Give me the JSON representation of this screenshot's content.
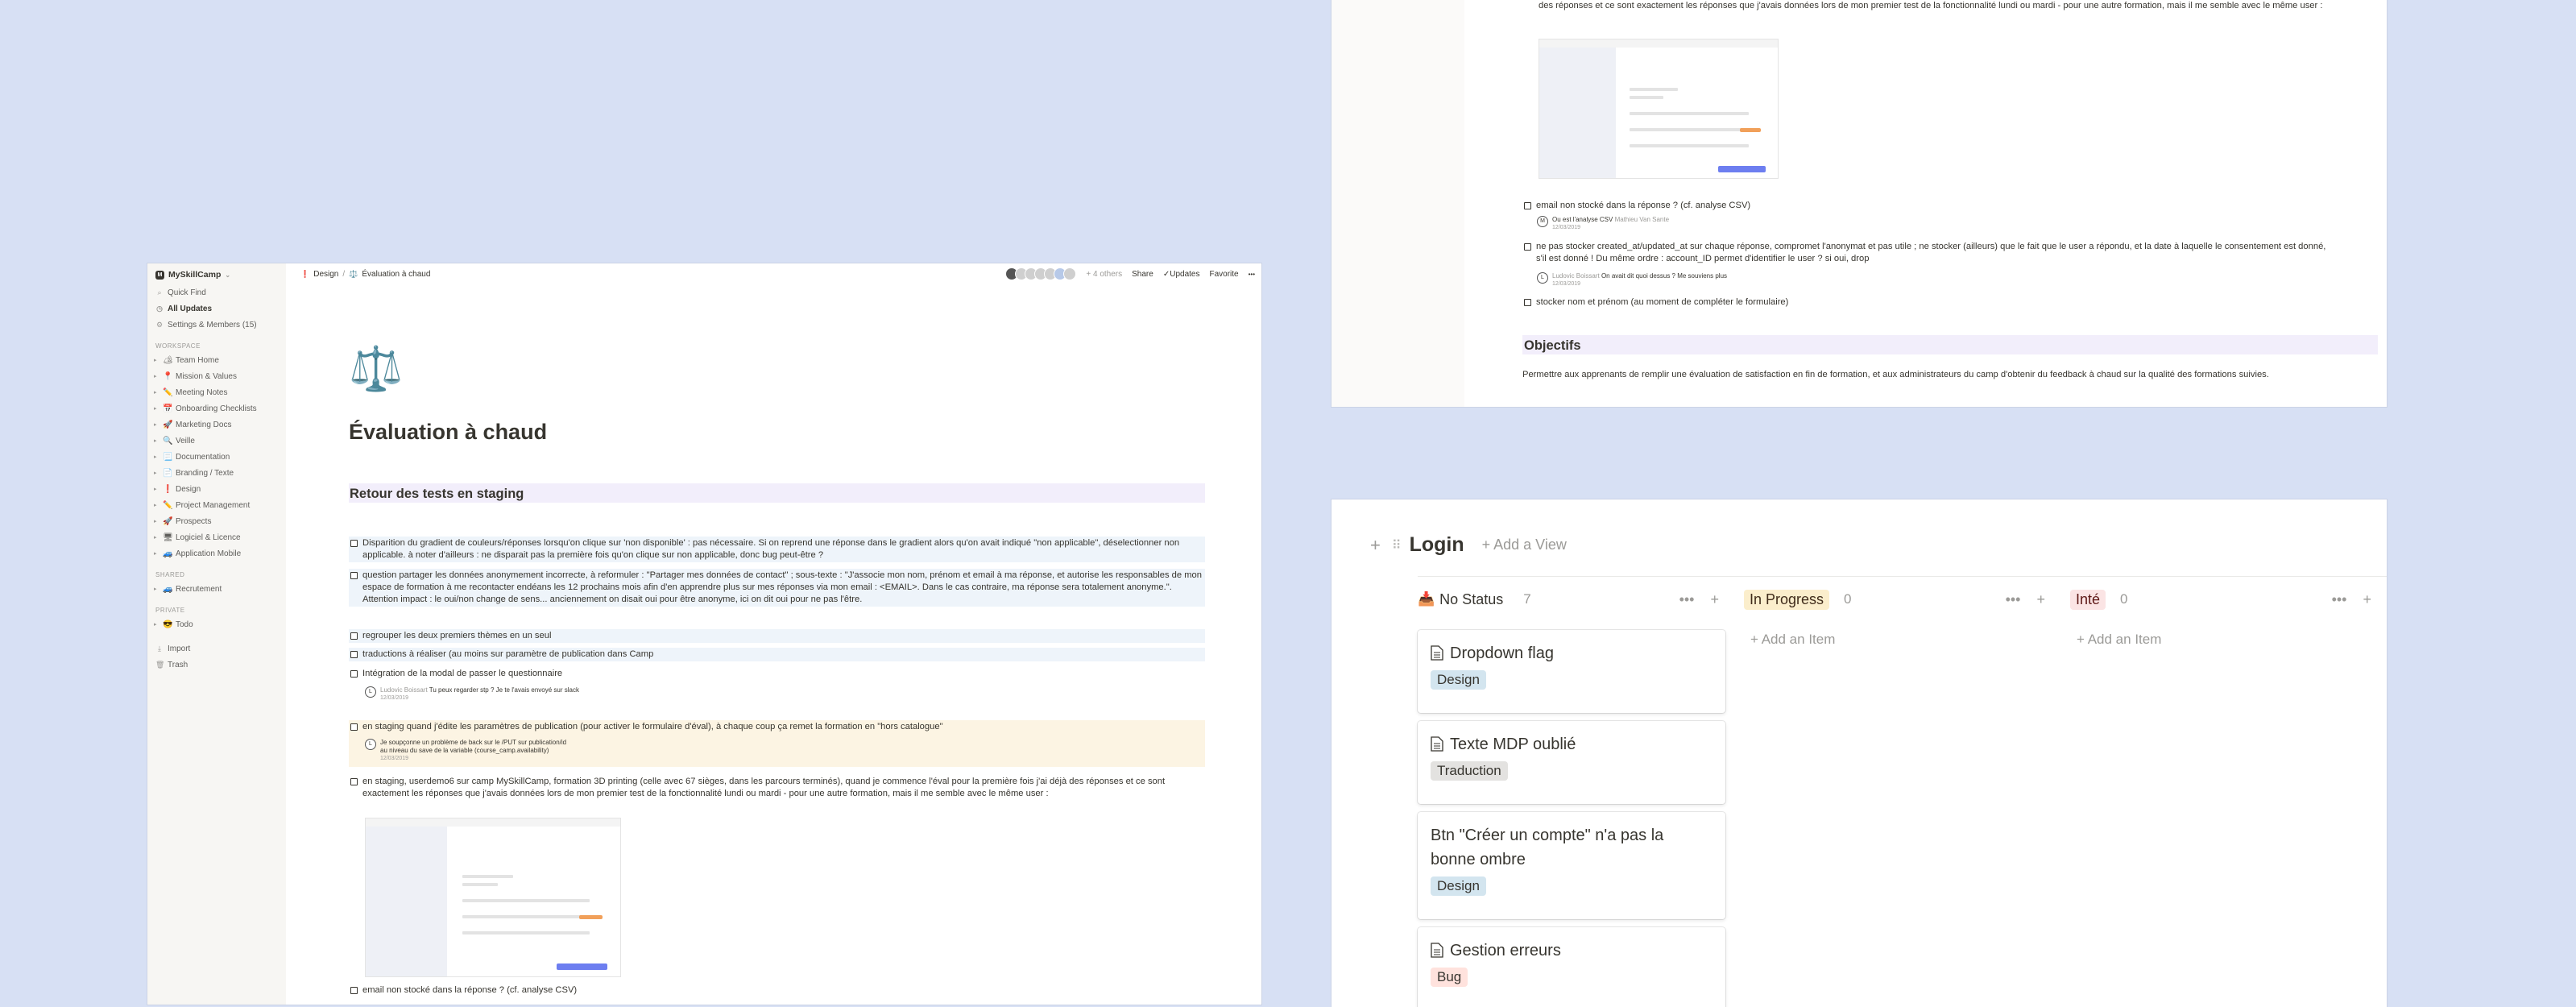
{
  "sidebar": {
    "workspace_name": "MySkillCamp",
    "quick_find": "Quick Find",
    "all_updates": "All Updates",
    "settings": "Settings & Members (15)",
    "workspace_label": "WORKSPACE",
    "items": [
      {
        "emoji": "🏕",
        "label": "Team Home"
      },
      {
        "emoji": "📍",
        "label": "Mission & Values"
      },
      {
        "emoji": "✏️",
        "label": "Meeting Notes"
      },
      {
        "emoji": "📅",
        "label": "Onboarding Checklists"
      },
      {
        "emoji": "🚀",
        "label": "Marketing Docs"
      },
      {
        "emoji": "🔍",
        "label": "Veille"
      },
      {
        "emoji": "📃",
        "label": "Documentation"
      },
      {
        "emoji": "📄",
        "label": "Branding / Texte"
      },
      {
        "emoji": "❗",
        "label": "Design"
      },
      {
        "emoji": "✏️",
        "label": "Project Management"
      },
      {
        "emoji": "🚀",
        "label": "Prospects"
      },
      {
        "emoji": "🖥",
        "label": "Logiciel & Licence"
      },
      {
        "emoji": "🚙",
        "label": "Application Mobile"
      }
    ],
    "shared_label": "SHARED",
    "shared_items": [
      {
        "emoji": "🚙",
        "label": "Recrutement"
      }
    ],
    "private_label": "PRIVATE",
    "private_items": [
      {
        "emoji": "😎",
        "label": "Todo"
      }
    ],
    "import": "Import",
    "trash": "Trash"
  },
  "topbar": {
    "breadcrumb_1": "Design",
    "breadcrumb_2": "Évaluation à chaud",
    "others": "+ 4 others",
    "share": "Share",
    "updates": "Updates",
    "favorite": "Favorite",
    "more": "•••"
  },
  "page": {
    "icon": "⚖️",
    "title": "Évaluation à chaud",
    "section_title": "Retour des tests en staging",
    "todos": [
      "Disparition du gradient de couleurs/réponses lorsqu'on clique sur 'non disponible' : pas nécessaire. Si on reprend une réponse dans le gradient alors qu'on avait indiqué \"non applicable\", déselectionner non applicable. à noter d'ailleurs : ne disparait pas la première fois qu'on clique sur non applicable, donc bug peut-être ?",
      "question partager les données anonymement incorrecte, à reformuler : \"Partager mes données de contact\" ; sous-texte : \"J'associe mon nom, prénom et email à ma réponse, et autorise les responsables de mon espace de formation à me recontacter endéans les 12 prochains mois afin d'en apprendre plus sur mes réponses via mon email : <EMAIL>. Dans le cas contraire, ma réponse sera totalement anonyme.\". Attention impact : le oui/non change de sens... anciennement on disait oui pour être anonyme, ici on dit oui pour ne pas l'être.",
      "regrouper les deux premiers thèmes en un seul",
      "traductions à réaliser (au moins sur paramètre de publication dans Camp",
      "Intégration de la modal de passer le questionnaire",
      "en staging quand j'édite les paramètres de publication (pour activer le formulaire d'éval), à chaque coup ça remet la formation en \"hors catalogue\"",
      "en staging, userdemo6 sur camp MySkillCamp, formation 3D printing (celle avec 67 sièges, dans les parcours terminés), quand je commence l'éval pour la première fois j'ai déjà des réponses et ce sont exactement les réponses que j'avais données lors de mon premier test de la fonctionnalité lundi ou mardi - pour une autre formation, mais il me semble avec le même user :",
      "email non stocké dans la réponse ? (cf. analyse CSV)"
    ],
    "comment_1": {
      "author": "Ludovic Boissart",
      "text": "Tu peux regarder stp ? Je te l'avais envoyé sur slack",
      "date": "12/03/2019"
    },
    "comment_2": {
      "text": "Je soupçonne un problème de back sur le /PUT sur publication/id au niveau du save de la variable (course_camp.availability)",
      "date": "12/03/2019"
    }
  },
  "right_top": {
    "text_top": "des réponses et ce sont exactement les réponses que j'avais données lors de mon premier test de la fonctionnalité lundi ou mardi - pour une autre formation, mais il me semble avec le même user :",
    "todo_email": "email non stocké dans la réponse ? (cf. analyse CSV)",
    "comment_email": "Ou est l'analyse CSV",
    "comment_email_meta": "Mathieu Van Sante",
    "comment_email_date": "12/03/2019",
    "todo_storage": "ne pas stocker created_at/updated_at sur chaque réponse, compromet l'anonymat et pas utile ; ne stocker (ailleurs) que le fait que le user a répondu, et la date à laquelle le consentement est donné, s'il est donné ! Du même ordre : account_ID permet d'identifier le user ? si oui, drop",
    "comment_storage_author": "Ludovic Boissart",
    "comment_storage": "On avait dit quoi dessus ? Me souviens plus",
    "comment_storage_date": "12/03/2019",
    "todo_name": "stocker nom et prénom (au moment de compléter le formulaire)",
    "objectives_title": "Objectifs",
    "objectives_text": "Permettre aux apprenants de remplir une évaluation de satisfaction en fin de formation, et aux administrateurs du camp d'obtenir du feedback à chaud sur la qualité des formations suivies."
  },
  "board": {
    "title": "Login",
    "add_view": "+ Add a View",
    "columns": [
      {
        "name": "No Status",
        "count": "7",
        "color": "#ffffff",
        "text_color": "#37352f"
      },
      {
        "name": "In Progress",
        "count": "0",
        "color": "#fbeecc",
        "text_color": "#402c1b"
      },
      {
        "name": "Inté",
        "count": "0",
        "color": "#fbe4e4",
        "text_color": "#5d1715"
      }
    ],
    "add_item": "+ Add an Item",
    "cards": [
      {
        "title": "Dropdown flag",
        "tag": "Design",
        "tag_color": "#d3e5ef"
      },
      {
        "title": "Texte MDP oublié",
        "tag": "Traduction",
        "tag_color": "#e3e2e0"
      },
      {
        "title": "Btn \"Créer un compte\" n'a pas la bonne ombre",
        "tag": "Design",
        "tag_color": "#d3e5ef"
      },
      {
        "title": "Gestion erreurs",
        "tag": "Bug",
        "tag_color": "#ffe2dd"
      }
    ]
  }
}
